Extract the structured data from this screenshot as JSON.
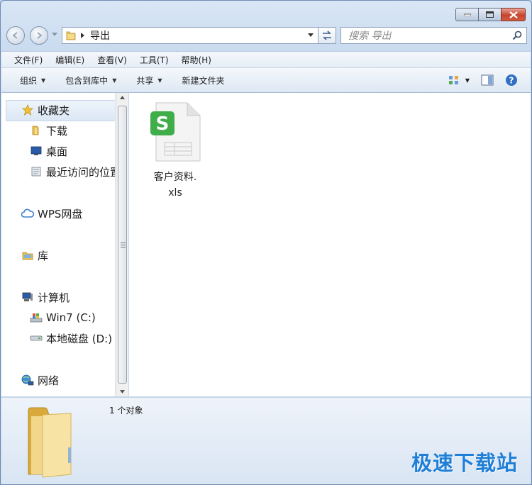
{
  "window": {
    "address_crumb": "导出",
    "search_placeholder": "搜索 导出"
  },
  "menu": [
    "文件(F)",
    "编辑(E)",
    "查看(V)",
    "工具(T)",
    "帮助(H)"
  ],
  "commands": [
    {
      "label": "组织",
      "dropdown": true
    },
    {
      "label": "包含到库中",
      "dropdown": true
    },
    {
      "label": "共享",
      "dropdown": true
    },
    {
      "label": "新建文件夹",
      "dropdown": false
    }
  ],
  "nav": {
    "favorites": "收藏夹",
    "downloads": "下载",
    "desktop": "桌面",
    "recent": "最近访问的位置",
    "wps": "WPS网盘",
    "library": "库",
    "computer": "计算机",
    "drive_c": "Win7 (C:)",
    "drive_d": "本地磁盘 (D:)",
    "network": "网络"
  },
  "files": [
    {
      "name_line1": "客户资料.",
      "name_line2": "xls",
      "icon": "wps-spreadsheet-icon",
      "badge": "S"
    }
  ],
  "status": {
    "item_count": "1 个对象"
  },
  "watermark": "极速下载站",
  "colors": {
    "wps_green": "#3fae49",
    "close_red": "#c7442d",
    "watermark_blue": "#1f7fd6"
  }
}
